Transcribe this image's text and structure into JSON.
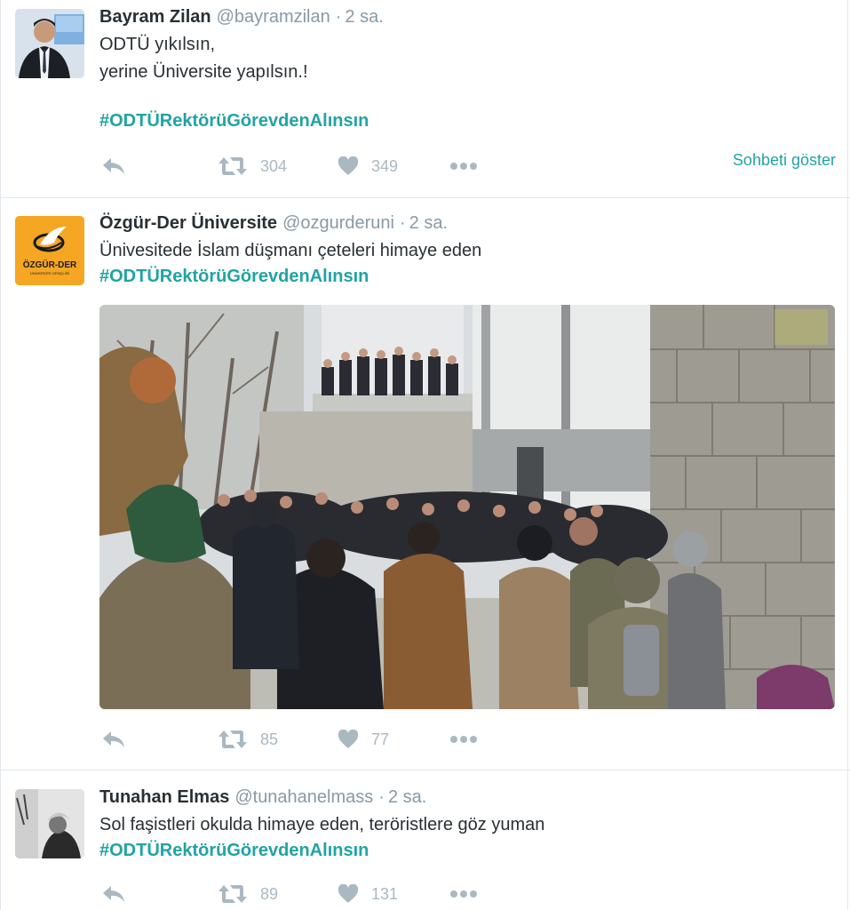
{
  "tweets": [
    {
      "name": "Bayram Zilan",
      "handle": "@bayramzilan",
      "time": "2 sa.",
      "lines": [
        "ODTÜ yıkılsın,",
        "yerine Üniversite yapılsın.!"
      ],
      "hashtag": "#ODTÜRektörüGörevdenAlınsın",
      "retweets": "304",
      "likes": "349",
      "conversation": "Sohbeti göster"
    },
    {
      "name": "Özgür-Der Üniversite",
      "handle": "@ozgurderuni",
      "time": "2 sa.",
      "lines": [
        "Ünivesitede İslam düşmanı çeteleri himaye eden"
      ],
      "hashtag": "#ODTÜRektörüGörevdenAlınsın",
      "retweets": "85",
      "likes": "77",
      "avatar_logo_text": "ÖZGÜR-DER",
      "avatar_logo_subtext": "ÜNİVERSİTE GENÇLİĞİ"
    },
    {
      "name": "Tunahan Elmas",
      "handle": "@tunahanelmass",
      "time": "2 sa.",
      "lines": [
        "Sol faşistleri okulda himaye eden, teröristlere göz yuman"
      ],
      "hashtag": "#ODTÜRektörüGörevdenAlınsın",
      "retweets": "89",
      "likes": "131"
    }
  ],
  "colors": {
    "hashtag": "#21a3a3",
    "icon_gray": "#aab8c2",
    "meta_gray": "#8899a6",
    "avatar_orange": "#f5a623"
  },
  "icons": [
    "reply-icon",
    "retweet-icon",
    "heart-icon",
    "more-icon"
  ]
}
